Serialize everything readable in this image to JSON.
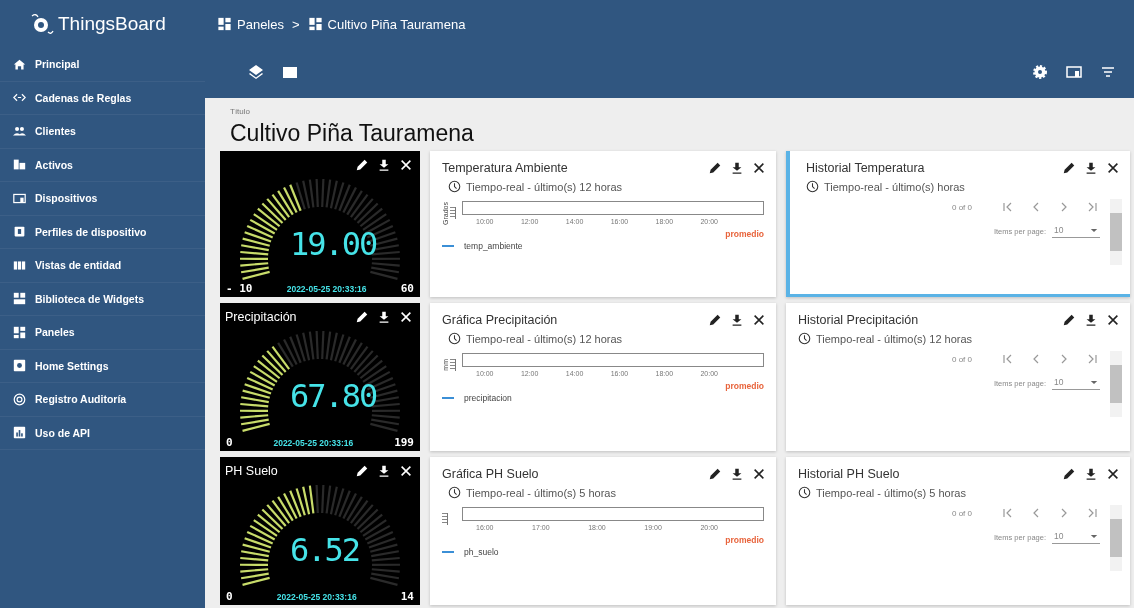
{
  "app": {
    "name": "ThingsBoard"
  },
  "breadcrumb": [
    {
      "label": "Paneles"
    },
    {
      "label": "Cultivo Piña Tauramena"
    }
  ],
  "breadcrumb_separator": ">",
  "sidebar": {
    "items": [
      {
        "label": "Principal"
      },
      {
        "label": "Cadenas de Reglas"
      },
      {
        "label": "Clientes"
      },
      {
        "label": "Activos"
      },
      {
        "label": "Dispositivos"
      },
      {
        "label": "Perfiles de dispositivo"
      },
      {
        "label": "Vistas de entidad"
      },
      {
        "label": "Biblioteca de Widgets"
      },
      {
        "label": "Paneles"
      },
      {
        "label": "Home Settings"
      },
      {
        "label": "Registro Auditoría"
      },
      {
        "label": "Uso de API"
      }
    ]
  },
  "dashboard": {
    "title_label": "Título",
    "title": "Cultivo Piña Tauramena"
  },
  "rows": [
    {
      "gauge": {
        "value": "19.00",
        "min": "- 10",
        "max": "60",
        "timestamp": "2022-05-25 20:33:16"
      },
      "chart": {
        "title": "Temperatura Ambiente",
        "timewindow": "Tiempo-real - último(s) 12 horas",
        "ylabel": "Grados",
        "xticks": [
          "10:00",
          "12:00",
          "14:00",
          "16:00",
          "18:00",
          "20:00"
        ],
        "aggregation": "promedio",
        "legend": "temp_ambiente"
      },
      "table": {
        "title": "Historial Temperatura",
        "timewindow": "Tiempo-real - último(s) horas",
        "range": "0 of 0",
        "page_size_label": "Items per page:",
        "page_size": "10",
        "highlighted": true
      }
    },
    {
      "gauge": {
        "title": "Precipitación",
        "value": "67.80",
        "min": "0",
        "max": "199",
        "timestamp": "2022-05-25 20:33:16"
      },
      "chart": {
        "title": "Gráfica Precipitación",
        "timewindow": "Tiempo-real - último(s) 12 horas",
        "ylabel": "mm",
        "xticks": [
          "10:00",
          "12:00",
          "14:00",
          "16:00",
          "18:00",
          "20:00"
        ],
        "aggregation": "promedio",
        "legend": "precipitacion"
      },
      "table": {
        "title": "Historial Precipitación",
        "timewindow": "Tiempo-real - último(s) 12 horas",
        "range": "0 of 0",
        "page_size_label": "Items per page:",
        "page_size": "10",
        "highlighted": false
      }
    },
    {
      "gauge": {
        "title": "PH Suelo",
        "value": "6.52",
        "min": "0",
        "max": "14",
        "timestamp": "2022-05-25 20:33:16"
      },
      "chart": {
        "title": "Gráfica PH Suelo",
        "timewindow": "Tiempo-real - último(s) 5 horas",
        "xticks": [
          "16:00",
          "17:00",
          "18:00",
          "19:00",
          "20:00"
        ],
        "aggregation": "promedio",
        "legend": "ph_suelo"
      },
      "table": {
        "title": "Historial PH Suelo",
        "timewindow": "Tiempo-real - último(s) 5 horas",
        "range": "0 of 0",
        "page_size_label": "Items per page:",
        "page_size": "10",
        "highlighted": false
      }
    }
  ]
}
